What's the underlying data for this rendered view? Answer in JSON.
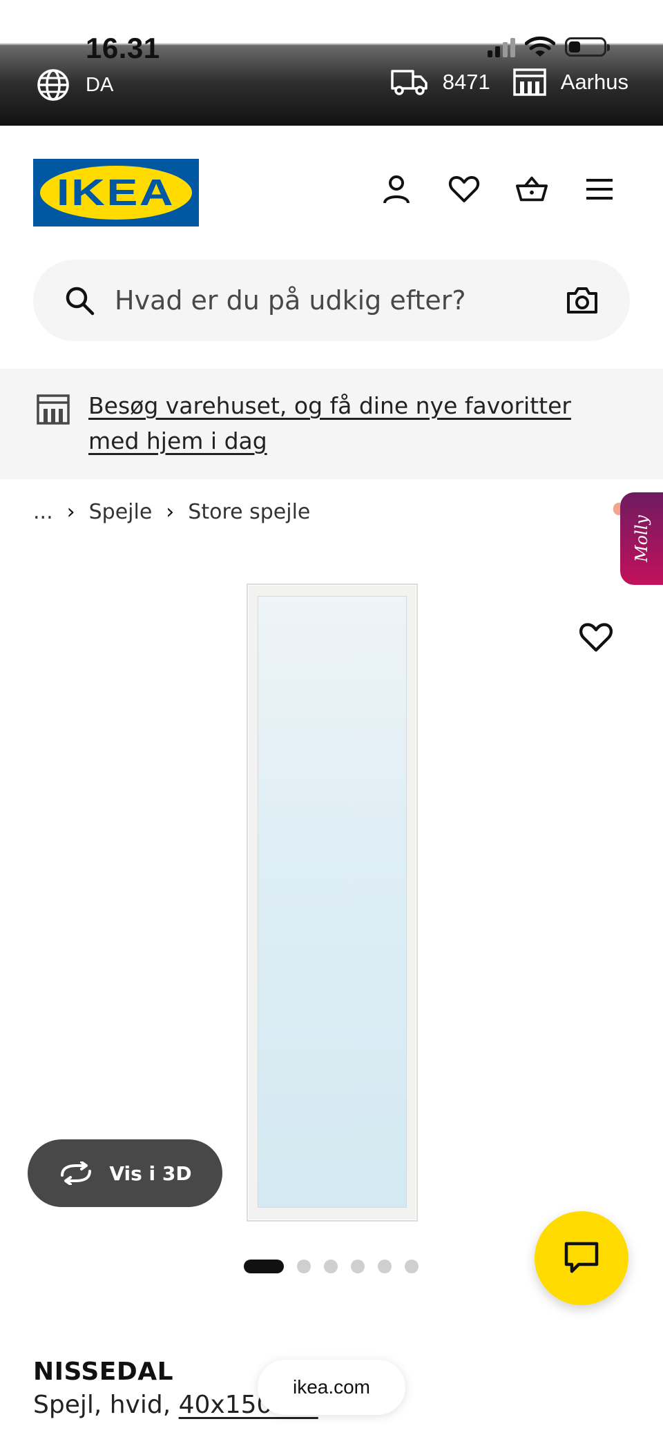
{
  "status_bar": {
    "time": "16.31"
  },
  "top_bar": {
    "language": "DA",
    "postal_code": "8471",
    "store": "Aarhus"
  },
  "header": {
    "logo_text": "IKEA"
  },
  "search": {
    "placeholder": "Hvad er du på udkig efter?"
  },
  "banner": {
    "text": "Besøg varehuset, og få dine nye favoritter med hjem i dag"
  },
  "breadcrumb": {
    "items": [
      "...",
      "Spejle",
      "Store spejle"
    ]
  },
  "assistant_tab": {
    "label": "Molly"
  },
  "product_image": {
    "view_3d_label": "Vis i 3D",
    "image_count": 6,
    "active_index": 0
  },
  "product": {
    "name": "NISSEDAL",
    "desc_prefix": "Spejl, hvid, ",
    "desc_size": "40x150 cm"
  },
  "browser": {
    "url": "ikea.com"
  },
  "colors": {
    "ikea_blue": "#0058a3",
    "ikea_yellow": "#ffdb00",
    "molly_gradient_start": "#6e1b60",
    "molly_gradient_end": "#c3115c"
  }
}
